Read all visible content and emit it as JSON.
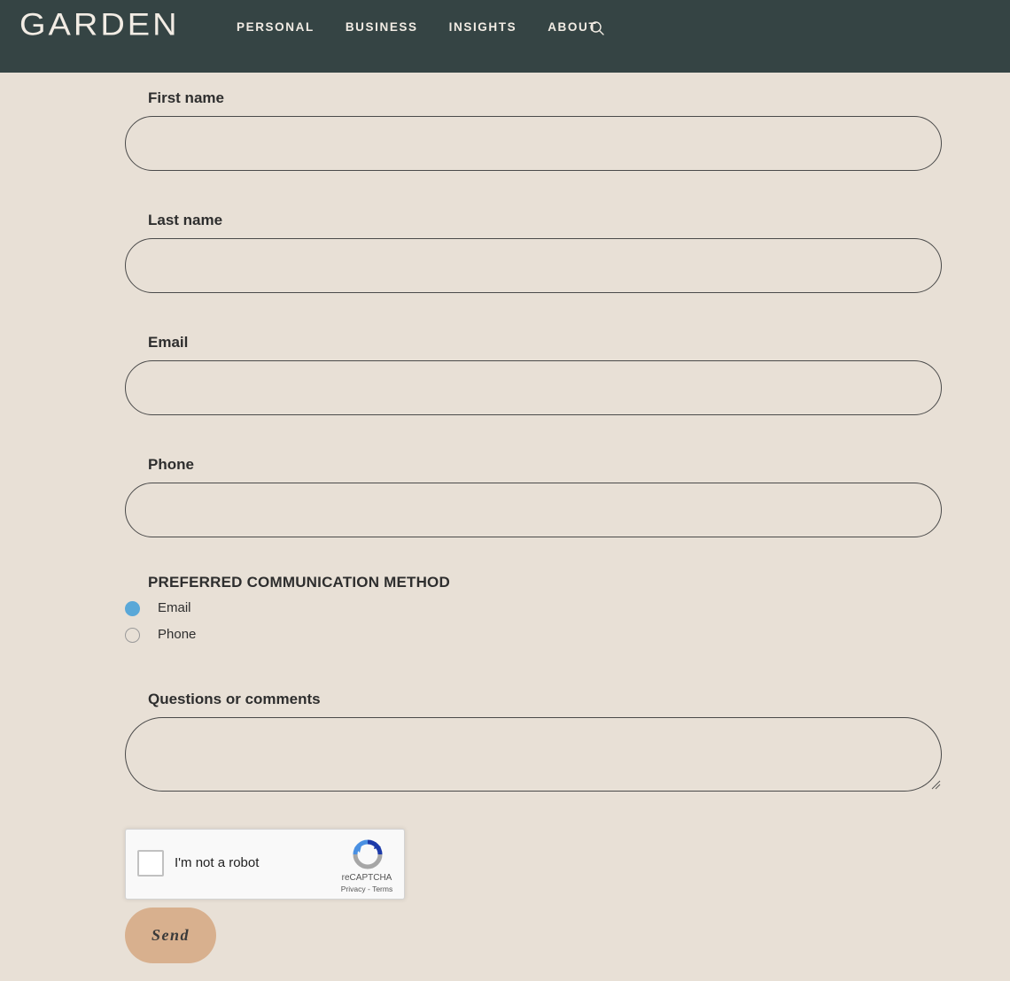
{
  "header": {
    "logo": "GARDEN",
    "nav": [
      {
        "label": "PERSONAL"
      },
      {
        "label": "BUSINESS"
      },
      {
        "label": "INSIGHTS"
      },
      {
        "label": "ABOUT"
      }
    ],
    "search_icon": "search-icon"
  },
  "form": {
    "first_name": {
      "label": "First name",
      "value": ""
    },
    "last_name": {
      "label": "Last name",
      "value": ""
    },
    "email": {
      "label": "Email",
      "value": ""
    },
    "phone": {
      "label": "Phone",
      "value": ""
    },
    "communication": {
      "heading": "PREFERRED COMMUNICATION METHOD",
      "options": [
        {
          "label": "Email",
          "selected": true
        },
        {
          "label": "Phone",
          "selected": false
        }
      ]
    },
    "comments": {
      "label": "Questions or comments",
      "value": ""
    },
    "captcha": {
      "label": "I'm not a robot",
      "brand": "reCAPTCHA",
      "privacy": "Privacy",
      "separator": "-",
      "terms": "Terms"
    },
    "submit_label": "Send"
  },
  "colors": {
    "header_bg": "#354444",
    "page_bg": "#e8e0d6",
    "radio_selected": "#5aa8d8",
    "button_bg": "#d8b08e"
  }
}
